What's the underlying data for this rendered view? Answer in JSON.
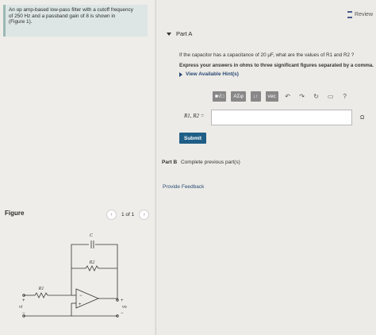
{
  "problem": {
    "text_1": "An op amp-based low-pass filter with a cutoff frequency",
    "text_2": "of 250 Hz and a passband gain of 8 is shown in",
    "text_3": "(Figure 1)."
  },
  "figure": {
    "label": "Figure",
    "pager": "1 of 1",
    "labels": {
      "c": "C",
      "r2": "R2",
      "r1": "R1",
      "vi": "vi",
      "vo": "vo"
    }
  },
  "header": {
    "review": "Review"
  },
  "part_a": {
    "title": "Part A",
    "question": "If the capacitor has a capacitance of 20 μF, what are the values of R1 and R2 ?",
    "instruction": "Express your answers in ohms to three significant figures separated by a comma.",
    "hints": "View Available Hint(s)",
    "toolbar": {
      "templates": "■√□",
      "greek": "ΑΣφ",
      "arrows": "↓↑",
      "vec": "vec",
      "help": "?"
    },
    "answer_label": "R1, R2 =",
    "answer_value": "",
    "unit": "Ω",
    "submit": "Submit"
  },
  "part_b": {
    "title": "Part B",
    "status": "Complete previous part(s)"
  },
  "feedback": "Provide Feedback",
  "colors": {
    "accent": "#1f5e87",
    "link": "#2a4a75",
    "problem_bg": "#dde6e4"
  }
}
